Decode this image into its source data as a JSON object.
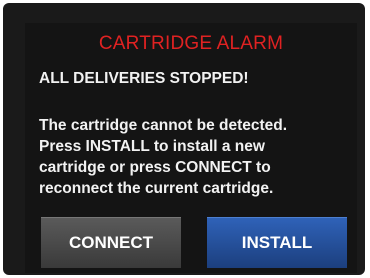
{
  "alarm": {
    "title": "CARTRIDGE ALARM",
    "heading": "ALL DELIVERIES STOPPED!",
    "message_lines": [
      "The cartridge cannot be detected.",
      "Press INSTALL to install a new",
      "cartridge or press CONNECT to",
      "reconnect the current cartridge."
    ]
  },
  "buttons": {
    "connect_label": "CONNECT",
    "install_label": "INSTALL"
  },
  "colors": {
    "title": "#e02222",
    "install_button": "#2650a0",
    "connect_button": "#4a4a4a",
    "background": "#141414"
  }
}
